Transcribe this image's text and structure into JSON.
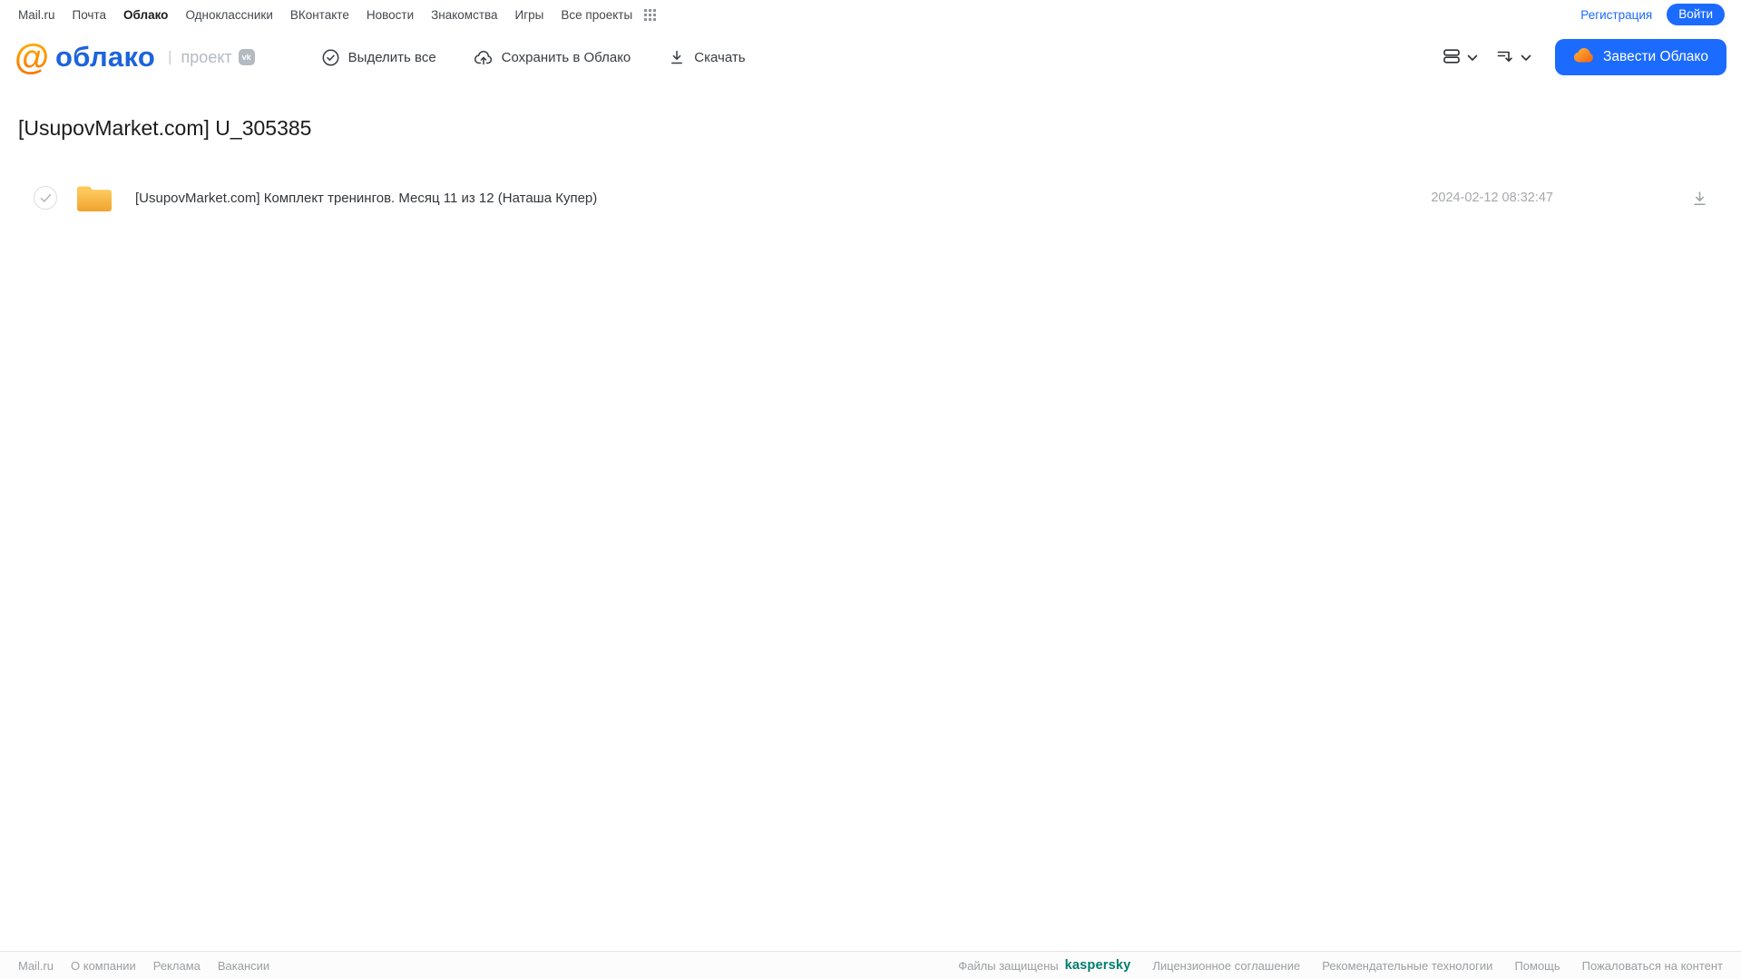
{
  "top_nav": {
    "links": [
      "Mail.ru",
      "Почта",
      "Облако",
      "Одноклассники",
      "ВКонтакте",
      "Новости",
      "Знакомства",
      "Игры",
      "Все проекты"
    ],
    "active_link": "Облако",
    "registration_label": "Регистрация",
    "login_label": "Войти"
  },
  "header": {
    "logo": {
      "at_sign": "@",
      "wordmark": "облако",
      "separator": "|",
      "project_label": "проект",
      "vk_badge": "vk"
    },
    "toolbar": {
      "select_all_label": "Выделить все",
      "save_to_cloud_label": "Сохранить в Облако",
      "download_label": "Скачать"
    },
    "create_cloud_label": "Завести Облако"
  },
  "main": {
    "title": "[UsupovMarket.com] U_305385",
    "files": [
      {
        "type": "folder",
        "name": "[UsupovMarket.com] Комплект тренингов. Месяц 11 из 12 (Наташа Купер)",
        "date": "2024-02-12 08:32:47"
      }
    ]
  },
  "footer": {
    "left_links": [
      "Mail.ru",
      "О компании",
      "Реклама",
      "Вакансии"
    ],
    "protected_label": "Файлы защищены",
    "kaspersky_label": "kaspersky",
    "right_links": [
      "Лицензионное соглашение",
      "Рекомендательные технологии",
      "Помощь",
      "Пожаловаться на контент"
    ]
  },
  "colors": {
    "accent_blue": "#1c6bff",
    "logo_blue": "#1d63dc",
    "logo_orange": "#f97400",
    "folder_top": "#ffd166",
    "folder_bottom": "#f0a32f",
    "kaspersky_teal": "#007c6c",
    "muted_gray": "#9b9ea1"
  }
}
